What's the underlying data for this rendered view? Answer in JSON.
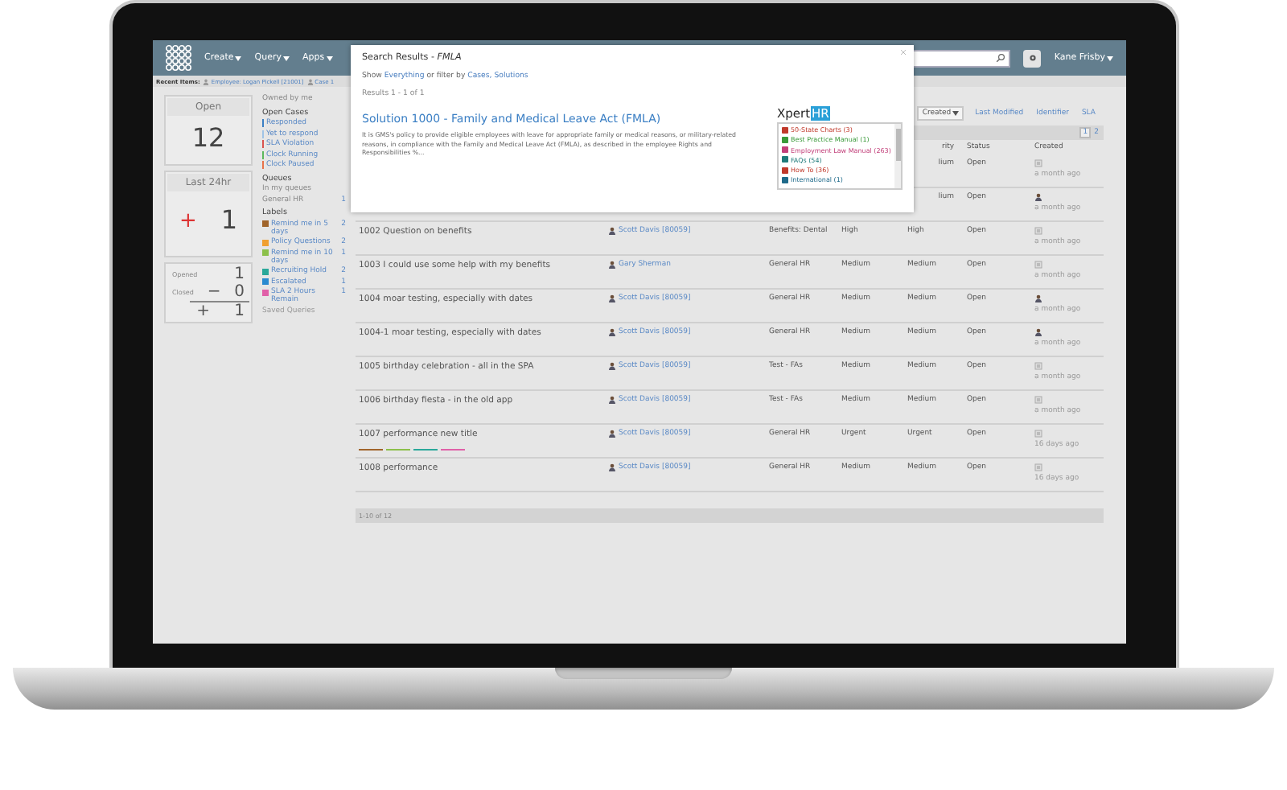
{
  "top_bar": {
    "menus": [
      {
        "label": "Create"
      },
      {
        "label": "Query"
      },
      {
        "label": "Apps"
      }
    ],
    "user": "Kane Frisby"
  },
  "recent_items": {
    "label": "Recent Items:",
    "items": [
      "Employee: Logan Pickell [21001]",
      "Case 1"
    ]
  },
  "stats": {
    "open": {
      "label": "Open",
      "value": "12"
    },
    "last_24hr": {
      "label": "Last 24hr",
      "sign": "+",
      "value": "1"
    },
    "tally": {
      "opened_label": "Opened",
      "opened": "1",
      "closed_label": "Closed",
      "closed_sign": "−",
      "closed": "0",
      "net_sign": "+",
      "net": "1"
    }
  },
  "filters": {
    "owned": "Owned by me",
    "open_cases": {
      "title": "Open Cases",
      "items": [
        {
          "label": "Responded",
          "color": "#3b7fc4"
        },
        {
          "label": "Yet to respond",
          "color": "#9fc3e6"
        },
        {
          "label": "SLA Violation",
          "color": "#d9534f"
        },
        {
          "label": "Clock Running",
          "color": "#5cb85c"
        },
        {
          "label": "Clock Paused",
          "color": "#e8734a"
        }
      ]
    },
    "queues": {
      "title": "Queues",
      "items": [
        {
          "label": "In my queues"
        },
        {
          "label": "General HR",
          "count": "1"
        }
      ]
    },
    "labels": {
      "title": "Labels",
      "items": [
        {
          "label": "Remind me in 5 days",
          "count": "2",
          "color": "#a0642a"
        },
        {
          "label": "Policy Questions",
          "count": "2",
          "color": "#f0a030"
        },
        {
          "label": "Remind me in 10 days",
          "count": "1",
          "color": "#8cc04a"
        },
        {
          "label": "Recruiting Hold",
          "count": "2",
          "color": "#2aa89a"
        },
        {
          "label": "Escalated",
          "count": "1",
          "color": "#2a8ad0"
        },
        {
          "label": "SLA 2 Hours Remain",
          "count": "1",
          "color": "#e060a8"
        }
      ]
    },
    "saved_queries": "Saved Queries"
  },
  "sort": [
    {
      "label": "Created",
      "selected": true
    },
    {
      "label": "Last Modified",
      "selected": false
    },
    {
      "label": "Identifier",
      "selected": false
    },
    {
      "label": "SLA",
      "selected": false
    }
  ],
  "pages": [
    {
      "label": "1",
      "selected": true
    },
    {
      "label": "2",
      "selected": false
    }
  ],
  "table": {
    "columns": {
      "priority": "rity",
      "status": "Status",
      "created": "Created"
    },
    "rows": [
      {
        "priority": "lium",
        "status": "Open",
        "kind": "box",
        "created": "a month ago"
      },
      {
        "priority": "lium",
        "status": "Open",
        "kind": "person",
        "created": "a month ago"
      },
      {
        "subject": "1002 Question on benefits",
        "requester": "Scott Davis [80059]",
        "category": "Benefits: Dental",
        "urgency": "High",
        "priority": "High",
        "status": "Open",
        "kind": "box",
        "created": "a month ago"
      },
      {
        "subject": "1003 I could use some help with my benefits",
        "requester": "Gary Sherman",
        "category": "General HR",
        "urgency": "Medium",
        "priority": "Medium",
        "status": "Open",
        "kind": "box",
        "created": "a month ago"
      },
      {
        "subject": "1004 moar testing, especially with dates",
        "requester": "Scott Davis [80059]",
        "category": "General HR",
        "urgency": "Medium",
        "priority": "Medium",
        "status": "Open",
        "kind": "person",
        "created": "a month ago"
      },
      {
        "subject": "1004-1 moar testing, especially with dates",
        "requester": "Scott Davis [80059]",
        "category": "General HR",
        "urgency": "Medium",
        "priority": "Medium",
        "status": "Open",
        "kind": "person",
        "created": "a month ago"
      },
      {
        "subject": "1005 birthday celebration - all in the SPA",
        "requester": "Scott Davis [80059]",
        "category": "Test - FAs",
        "urgency": "Medium",
        "priority": "Medium",
        "status": "Open",
        "kind": "box",
        "created": "a month ago"
      },
      {
        "subject": "1006 birthday fiesta - in the old app",
        "requester": "Scott Davis [80059]",
        "category": "Test - FAs",
        "urgency": "Medium",
        "priority": "Medium",
        "status": "Open",
        "kind": "box",
        "created": "a month ago"
      },
      {
        "subject": "1007 performance new title",
        "requester": "Scott Davis [80059]",
        "category": "General HR",
        "urgency": "Urgent",
        "priority": "Urgent",
        "status": "Open",
        "kind": "box",
        "created": "16 days ago",
        "labels": [
          {
            "color": "#a0642a"
          },
          {
            "color": "#8cc04a"
          },
          {
            "color": "#2aa89a"
          },
          {
            "color": "#e060a8"
          }
        ]
      },
      {
        "subject": "1008 performance",
        "requester": "Scott Davis [80059]",
        "category": "General HR",
        "urgency": "Medium",
        "priority": "Medium",
        "status": "Open",
        "kind": "box",
        "created": "16 days ago"
      }
    ],
    "footer": "1-10 of 12"
  },
  "modal": {
    "title": "Search Results - *FMLA*",
    "show": "Show",
    "everything": "Everything",
    "filter_by": "or filter by",
    "filters": [
      "Cases,",
      "Solutions"
    ],
    "results": "Results 1 - 1 of 1",
    "result_title": "Solution 1000 - Family and Medical Leave Act (FMLA)",
    "result_text": "It is GMS's policy to provide eligible employees with leave for appropriate family or medical reasons, or military-related reasons, in compliance with the Family and Medical Leave Act (FMLA), as described in the employee Rights and Responsibilities %...",
    "brand": "Xpert",
    "brand_badge": "HR",
    "resources": [
      {
        "label": "50-State Charts (3)",
        "color": "#c0392b"
      },
      {
        "label": "Best Practice Manual (1)",
        "color": "#3a9a3a"
      },
      {
        "label": "Employment Law Manual (263)",
        "color": "#c2407a"
      },
      {
        "label": "FAQs (54)",
        "color": "#1f7a7a"
      },
      {
        "label": "How To (36)",
        "color": "#c0392b"
      },
      {
        "label": "International (1)",
        "color": "#1f6a8a"
      }
    ]
  }
}
